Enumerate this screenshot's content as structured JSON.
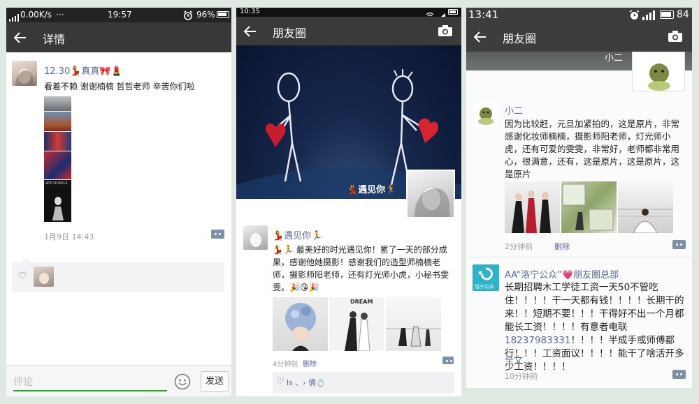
{
  "screen1": {
    "status": {
      "speed": "0.00K/s",
      "dots": "···",
      "time": "19:57",
      "battery": "96%"
    },
    "header": {
      "title": "详情"
    },
    "post": {
      "author": "12.30💃真真🎀💄",
      "text": "看着不赖 谢谢楠楠 哲哲老师 辛苦你们啦",
      "timestamp": "1月9日 14:43",
      "thumb_caption": "WEDDINGS"
    },
    "likes": {
      "heart": "♡"
    },
    "comment_bar": {
      "placeholder": "评论",
      "send_label": "发送"
    }
  },
  "screen2": {
    "status": {
      "time": "10:35"
    },
    "header": {
      "title": "朋友圈"
    },
    "cover": {
      "profile_name": "💃遇见你🏃"
    },
    "post": {
      "author": "💃遇见你🏃",
      "text": "💃🏃 最美好的时光遇见你！累了一天的部分成果，感谢他她摄影！感谢我们的造型师楠楠老师，摄影师阳老师，还有灯光师小虎，小秘书雯雯。🎉😘🎉",
      "photo_caption": "DREAM",
      "time": "4分钟前",
      "delete": "删除"
    },
    "likes": {
      "heart": "♡",
      "names": "ls 、› 倩💍"
    }
  },
  "screen3": {
    "status": {
      "time": "13:41",
      "battery": "84"
    },
    "header": {
      "title": "朋友圈"
    },
    "cover": {
      "profile_name": "小二"
    },
    "post1": {
      "author": "小二",
      "text": "因为比较赶，元旦加紧拍的，这是原片，非常感谢化妆师楠楠，摄影师阳老师，灯光师小虎，还有可爱的雯雯，非常好，老师都非常用心，很满意，还有，这是原片，这是原片，这是原片",
      "time": "2分钟前",
      "delete": "删除"
    },
    "post2": {
      "author": "AA“洛宁公众”💗朋友圈总部",
      "avatar_text": "洛宁公众",
      "text_part1": "长期招聘木工学徒工资一天50不管吃住！！！！干一天都有钱！！！！长期干的来！！短期不要！！！干得好不出一个月都能长工资！！！！有意者电联",
      "phone": "18237983331",
      "text_part2": "！！！！半成手或师傅都行！！！工资面议！！！！能干了啥活开多少工资！！！！",
      "full_text": "全文",
      "time": "10分钟前"
    }
  },
  "colors": {
    "link": "#576b95",
    "header": "#383838",
    "status": "#232323",
    "send_green": "#1aad19"
  }
}
